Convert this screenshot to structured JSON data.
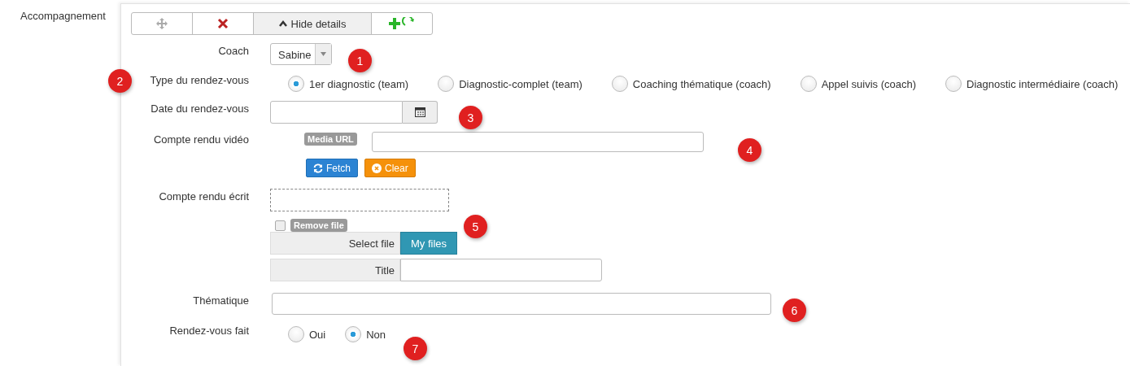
{
  "section_label": "Accompagnement",
  "toolbar": [
    {
      "kind": "move"
    },
    {
      "kind": "delete"
    },
    {
      "kind": "toggle",
      "label": "Hide details"
    },
    {
      "kind": "add"
    }
  ],
  "coach": {
    "label": "Coach",
    "value": "Sabine"
  },
  "meeting_type": {
    "label": "Type du rendez-vous",
    "options": [
      {
        "label": "1er diagnostic (team)",
        "selected": true
      },
      {
        "label": "Diagnostic-complet (team)",
        "selected": false
      },
      {
        "label": "Coaching thématique (coach)",
        "selected": false
      },
      {
        "label": "Appel suivis (coach)",
        "selected": false
      },
      {
        "label": "Diagnostic intermédiaire (coach)",
        "selected": false
      }
    ]
  },
  "date": {
    "label": "Date du rendez-vous"
  },
  "video_report": {
    "label": "Compte rendu vidéo",
    "tag": "Media URL",
    "fetch": "Fetch",
    "clear": "Clear"
  },
  "written_report": {
    "label": "Compte rendu écrit",
    "remove_file": {
      "label": "Remove file",
      "checked": false
    },
    "select_file": "Select file",
    "my_files": "My files",
    "title_label": "Title"
  },
  "theme": {
    "label": "Thématique"
  },
  "done": {
    "label": "Rendez-vous fait",
    "options": [
      {
        "label": "Oui",
        "selected": false
      },
      {
        "label": "Non",
        "selected": true
      }
    ]
  },
  "markers": [
    "1",
    "2",
    "3",
    "4",
    "5",
    "6",
    "7"
  ]
}
